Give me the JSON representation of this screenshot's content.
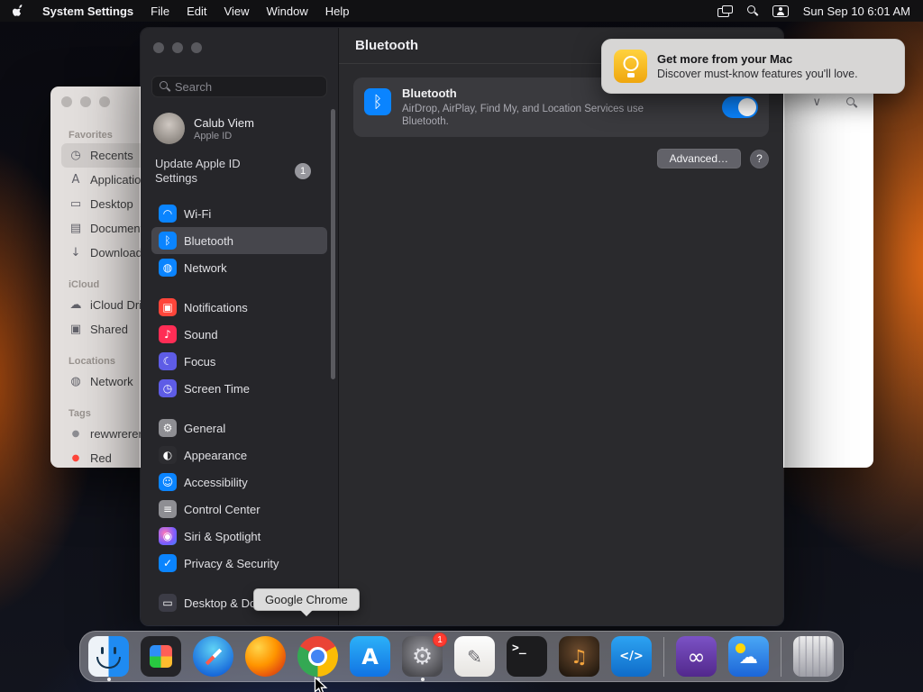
{
  "menu_bar": {
    "app_name": "System Settings",
    "menus": [
      "File",
      "Edit",
      "View",
      "Window",
      "Help"
    ],
    "clock": "Sun Sep 10 6:01 AM",
    "status_icons": [
      "windows-icon",
      "spotlight-icon",
      "user-icon"
    ]
  },
  "notification": {
    "icon": "lightbulb-icon",
    "title": "Get more from your Mac",
    "body": "Discover must-know features you'll love."
  },
  "settings": {
    "search_placeholder": "Search",
    "profile": {
      "name": "Calub Viem",
      "subtitle": "Apple ID"
    },
    "update": {
      "label": "Update Apple ID Settings",
      "badge": "1"
    },
    "nav": [
      {
        "label": "Wi-Fi",
        "glyph": "◠",
        "color": "#0a84ff"
      },
      {
        "label": "Bluetooth",
        "glyph": "ᛒ",
        "color": "#0a84ff",
        "selected": true
      },
      {
        "label": "Network",
        "glyph": "◍",
        "color": "#0a84ff"
      },
      {
        "label": "Notifications",
        "glyph": "▣",
        "color": "#ff453a"
      },
      {
        "label": "Sound",
        "glyph": "♪",
        "color": "#ff2d55"
      },
      {
        "label": "Focus",
        "glyph": "☾",
        "color": "#5e5ce6"
      },
      {
        "label": "Screen Time",
        "glyph": "◷",
        "color": "#5e5ce6"
      },
      {
        "label": "General",
        "glyph": "⚙",
        "color": "#8e8e93"
      },
      {
        "label": "Appearance",
        "glyph": "◐",
        "color": "#2c2c30"
      },
      {
        "label": "Accessibility",
        "glyph": "☺",
        "color": "#0a84ff"
      },
      {
        "label": "Control Center",
        "glyph": "≡",
        "color": "#8e8e93"
      },
      {
        "label": "Siri & Spotlight",
        "glyph": "◉",
        "color": "#a958e8"
      },
      {
        "label": "Privacy & Security",
        "glyph": "✓",
        "color": "#0a84ff"
      },
      {
        "label": "Desktop & Dock",
        "glyph": "▭",
        "color": "#3c3c46"
      }
    ],
    "content": {
      "title": "Bluetooth",
      "card_title": "Bluetooth",
      "card_desc": "AirDrop, AirPlay, Find My, and Location Services use Bluetooth.",
      "toggle_on": true,
      "advanced_label": "Advanced…",
      "help_label": "?"
    }
  },
  "finder": {
    "sections": [
      {
        "title": "Favorites",
        "items": [
          {
            "label": "Recents",
            "glyph": "◷",
            "selected": true
          },
          {
            "label": "Applications",
            "glyph": "A"
          },
          {
            "label": "Desktop",
            "glyph": "▭"
          },
          {
            "label": "Documents",
            "glyph": "▤"
          },
          {
            "label": "Downloads",
            "glyph": "↓"
          }
        ]
      },
      {
        "title": "iCloud",
        "items": [
          {
            "label": "iCloud Drive",
            "glyph": "☁"
          },
          {
            "label": "Shared",
            "glyph": "▣"
          }
        ]
      },
      {
        "title": "Locations",
        "items": [
          {
            "label": "Network",
            "glyph": "◍"
          }
        ]
      },
      {
        "title": "Tags",
        "items": [
          {
            "label": "rewwrerer",
            "glyph": "●",
            "color": "#8e8e93"
          },
          {
            "label": "Red",
            "glyph": "●",
            "color": "#ff453a"
          }
        ]
      }
    ]
  },
  "dock": {
    "tooltip": "Google Chrome",
    "items": [
      {
        "name": "finder-icon",
        "label": "Finder",
        "running": true
      },
      {
        "name": "launchpad-icon",
        "label": "Launchpad",
        "running": false
      },
      {
        "name": "safari-icon",
        "label": "Safari",
        "running": false
      },
      {
        "name": "firefox-icon",
        "label": "Firefox",
        "running": false
      },
      {
        "name": "chrome-icon",
        "label": "Google Chrome",
        "running": true
      },
      {
        "name": "app-store-icon",
        "label": "App Store",
        "glyph": "A",
        "running": false
      },
      {
        "name": "system-settings-icon",
        "label": "System Settings",
        "glyph": "⚙",
        "badge": "1",
        "running": true
      },
      {
        "name": "notes-icon",
        "label": "Notes",
        "glyph": "✎",
        "running": false
      },
      {
        "name": "terminal-icon",
        "label": "Terminal",
        "glyph": ">_",
        "running": false
      },
      {
        "name": "garageband-icon",
        "label": "GarageBand",
        "glyph": "♫",
        "running": false
      },
      {
        "name": "vscode-icon",
        "label": "Visual Studio Code",
        "glyph": "</>",
        "running": false
      },
      {
        "name": "visual-studio-icon",
        "label": "Visual Studio",
        "glyph": "∞",
        "running": false
      },
      {
        "name": "weather-icon",
        "label": "Weather",
        "glyph": "☁",
        "running": false
      },
      {
        "name": "trash-icon",
        "label": "Trash",
        "running": false
      }
    ]
  }
}
